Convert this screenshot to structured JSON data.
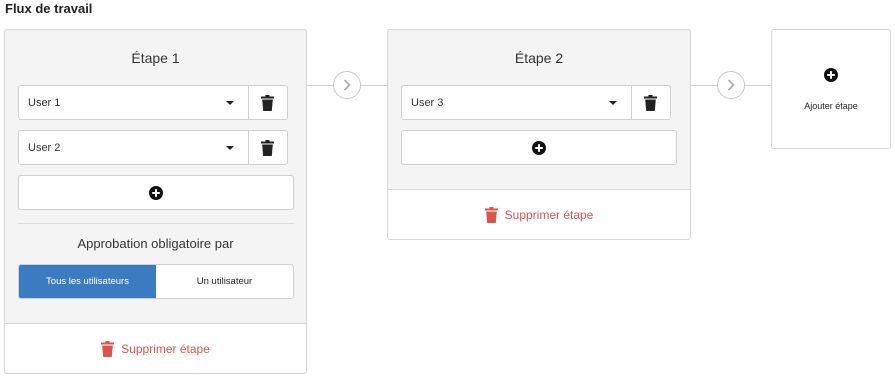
{
  "page_title": "Flux de travail",
  "stages": [
    {
      "title": "Étape 1",
      "users": [
        {
          "label": "User 1"
        },
        {
          "label": "User 2"
        }
      ],
      "approval_label": "Approbation obligatoire par",
      "approval_options": [
        "Tous les utilisateurs",
        "Un utilisateur"
      ],
      "approval_selected": "Tous les utilisateurs",
      "delete_label": "Supprimer étape"
    },
    {
      "title": "Étape 2",
      "users": [
        {
          "label": "User 3"
        }
      ],
      "delete_label": "Supprimer étape"
    }
  ],
  "add_stage_label": "Ajouter étape",
  "colors": {
    "accent": "#3a7cbf",
    "danger": "#d9534f",
    "panel_bg": "#f4f4f4"
  },
  "icons": {
    "delete": "trash-icon",
    "add": "plus-circle-icon",
    "next": "chevron-right-icon",
    "dropdown": "caret-down-icon"
  }
}
